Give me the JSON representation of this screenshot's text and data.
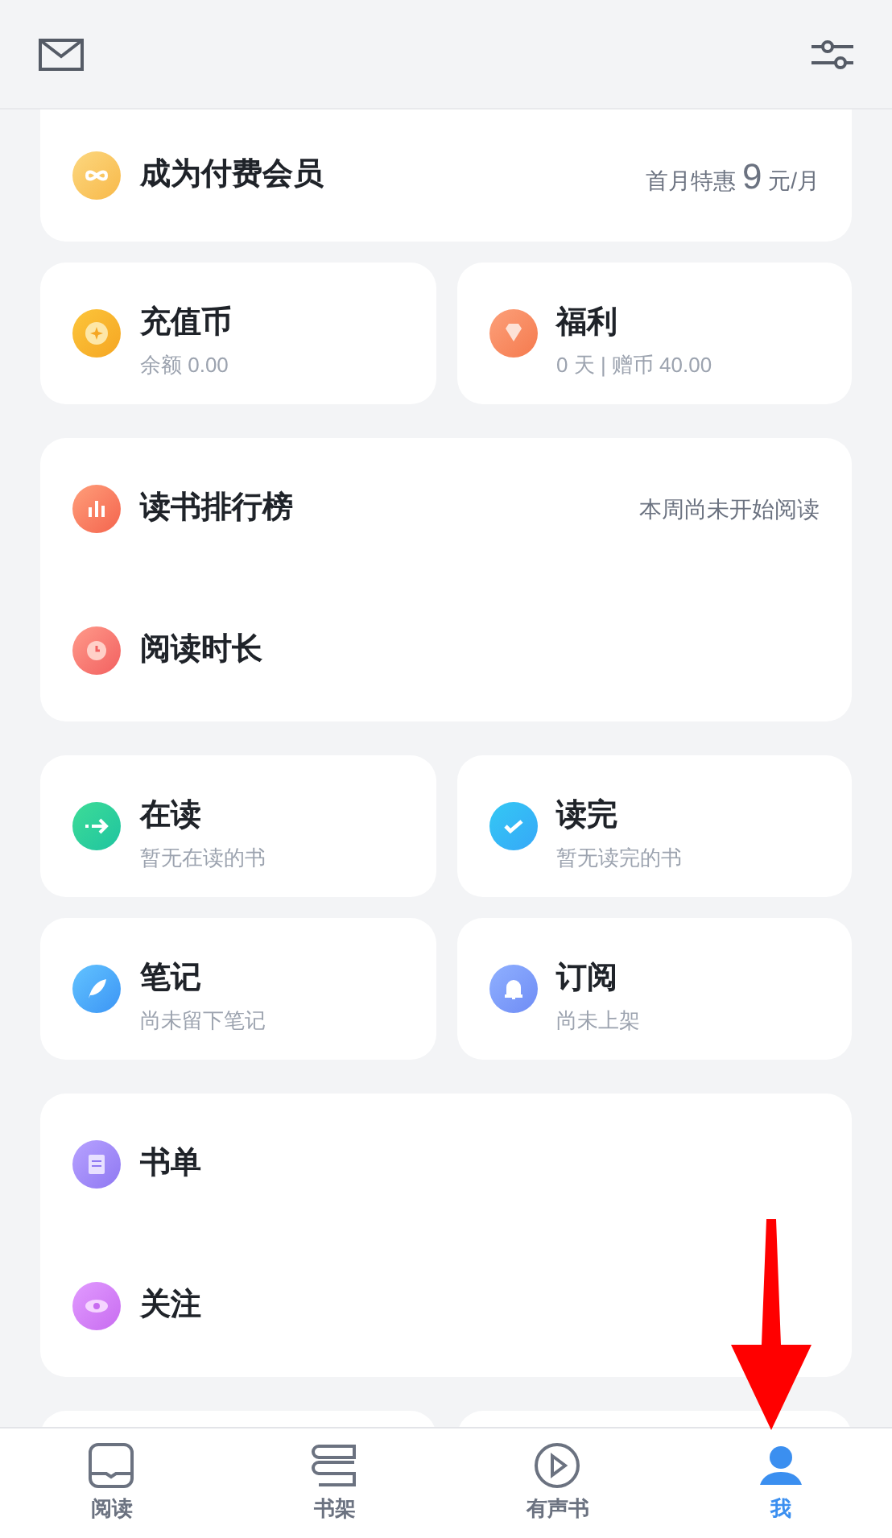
{
  "member": {
    "title": "成为付费会员",
    "offer_prefix": "首月特惠",
    "offer_price": "9",
    "offer_suffix": "元/月"
  },
  "groups": [
    {
      "kind": "tiles",
      "items": [
        {
          "title": "充值币",
          "subtitle": "余额 0.00"
        },
        {
          "title": "福利",
          "subtitle": "0 天 | 赠币 40.00"
        }
      ]
    },
    {
      "kind": "rows",
      "items": [
        {
          "title": "读书排行榜",
          "note": "本周尚未开始阅读"
        },
        {
          "title": "阅读时长"
        }
      ]
    },
    {
      "kind": "tiles",
      "items": [
        {
          "title": "在读",
          "subtitle": "暂无在读的书"
        },
        {
          "title": "读完",
          "subtitle": "暂无读完的书"
        }
      ]
    },
    {
      "kind": "tiles",
      "items": [
        {
          "title": "笔记",
          "subtitle": "尚未留下笔记"
        },
        {
          "title": "订阅",
          "subtitle": "尚未上架"
        }
      ]
    },
    {
      "kind": "rows",
      "items": [
        {
          "title": "书单"
        },
        {
          "title": "关注"
        }
      ]
    }
  ],
  "tabs": [
    {
      "label": "阅读",
      "selected": false
    },
    {
      "label": "书架",
      "selected": false
    },
    {
      "label": "有声书",
      "selected": false
    },
    {
      "label": "我",
      "selected": true
    }
  ]
}
